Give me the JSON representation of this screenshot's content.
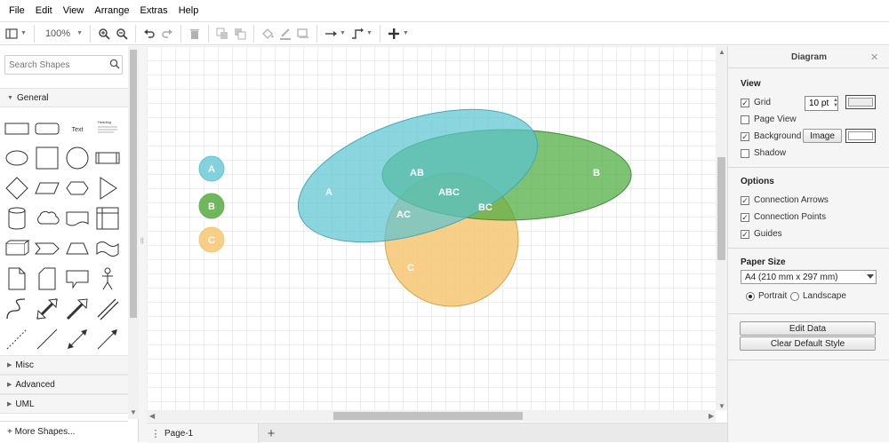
{
  "menu": [
    "File",
    "Edit",
    "View",
    "Arrange",
    "Extras",
    "Help"
  ],
  "toolbar": {
    "zoom": "100%"
  },
  "search": {
    "placeholder": "Search Shapes"
  },
  "sidebar": {
    "sections_top": [
      "General"
    ],
    "sections_bottom": [
      "Misc",
      "Advanced",
      "UML"
    ],
    "more_shapes": "+ More Shapes...",
    "text_shape_label": "Text",
    "heading_shape_label": "Heading"
  },
  "diagram": {
    "legend": [
      {
        "label": "A",
        "color": "#5ac3d1"
      },
      {
        "label": "B",
        "color": "#5fae4b"
      },
      {
        "label": "C",
        "color": "#f5c36b"
      }
    ],
    "labels": {
      "A": "A",
      "B": "B",
      "C": "C",
      "AB": "AB",
      "AC": "AC",
      "BC": "BC",
      "ABC": "ABC"
    },
    "colors": {
      "a_fill": "#5ac3d1",
      "b_fill": "#4caa3e",
      "c_fill": "#f5c36b"
    }
  },
  "pages": {
    "tab": "Page-1"
  },
  "panel": {
    "title": "Diagram",
    "view_heading": "View",
    "grid_label": "Grid",
    "grid_size": "10 pt",
    "page_view_label": "Page View",
    "background_label": "Background",
    "image_button": "Image",
    "shadow_label": "Shadow",
    "options_heading": "Options",
    "connection_arrows": "Connection Arrows",
    "connection_points": "Connection Points",
    "guides": "Guides",
    "paper_heading": "Paper Size",
    "paper_value": "A4 (210 mm x 297 mm)",
    "portrait": "Portrait",
    "landscape": "Landscape",
    "edit_data": "Edit Data",
    "clear_style": "Clear Default Style"
  }
}
